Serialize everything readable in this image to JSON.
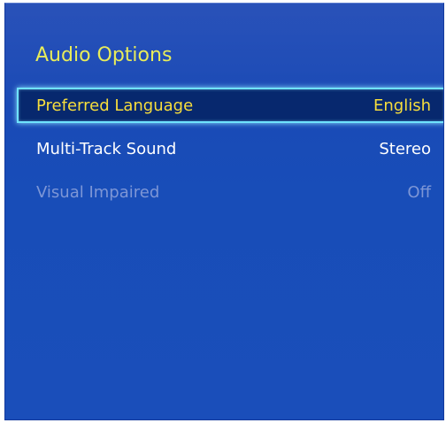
{
  "dialog": {
    "title": "Audio Options"
  },
  "menu": {
    "items": [
      {
        "label": "Preferred Language",
        "value": "English",
        "state": "selected"
      },
      {
        "label": "Multi-Track Sound",
        "value": "Stereo",
        "state": "normal"
      },
      {
        "label": "Visual Impaired",
        "value": "Off",
        "state": "disabled"
      }
    ]
  },
  "colors": {
    "background": "#1a4ab6",
    "title": "#e8ec5a",
    "selected_text": "#f7de3c",
    "selected_bg": "#07286e",
    "focus_border": "#6fe3ff",
    "normal_text": "#ffffff",
    "disabled_text": "#7d96d6"
  }
}
